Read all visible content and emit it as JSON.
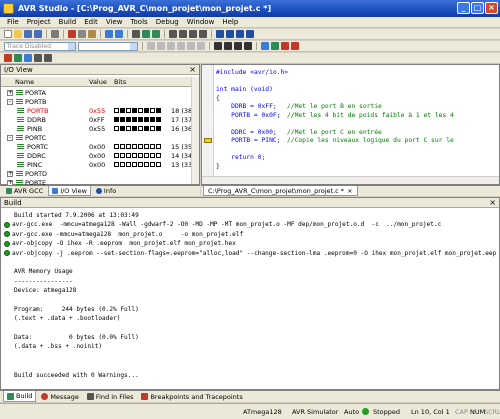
{
  "window": {
    "title": "AVR Studio - [C:\\Prog_AVR_C\\mon_projet\\mon_projet.c *]",
    "min": "_",
    "max": "□",
    "close": "×"
  },
  "menu": [
    "File",
    "Project",
    "Build",
    "Edit",
    "View",
    "Tools",
    "Debug",
    "Window",
    "Help"
  ],
  "toolbar": {
    "trace_combo": "Trace Disabled"
  },
  "io_view": {
    "title": "I/O View",
    "col_name": "Name",
    "col_value": "Value",
    "col_bits": "Bits",
    "rows": [
      {
        "expander": "+",
        "name": "PORTA",
        "value": "",
        "addr": "",
        "bits": []
      },
      {
        "expander": "-",
        "name": "PORTB",
        "value": "",
        "addr": "",
        "bits": []
      },
      {
        "expander": "",
        "name": "PORTB",
        "value": "0x55",
        "addr": "18 (38)",
        "bits": [
          0,
          1,
          0,
          1,
          0,
          1,
          0,
          1
        ],
        "red": true
      },
      {
        "expander": "",
        "name": "DDRB",
        "value": "0xFF",
        "addr": "17 (37)",
        "bits": [
          1,
          1,
          1,
          1,
          1,
          1,
          1,
          1
        ]
      },
      {
        "expander": "",
        "name": "PINB",
        "value": "0x55",
        "addr": "16 (36)",
        "bits": [
          0,
          1,
          0,
          1,
          0,
          1,
          0,
          1
        ]
      },
      {
        "expander": "-",
        "name": "PORTC",
        "value": "",
        "addr": "",
        "bits": []
      },
      {
        "expander": "",
        "name": "PORTC",
        "value": "0x00",
        "addr": "15 (35)",
        "bits": [
          0,
          0,
          0,
          0,
          0,
          0,
          0,
          0
        ]
      },
      {
        "expander": "",
        "name": "DDRC",
        "value": "0x00",
        "addr": "14 (34)",
        "bits": [
          0,
          0,
          0,
          0,
          0,
          0,
          0,
          0
        ]
      },
      {
        "expander": "",
        "name": "PINC",
        "value": "0x00",
        "addr": "13 (33)",
        "bits": [
          0,
          0,
          0,
          0,
          0,
          0,
          0,
          0
        ]
      },
      {
        "expander": "+",
        "name": "PORTD",
        "value": "",
        "addr": "",
        "bits": []
      },
      {
        "expander": "+",
        "name": "PORTE",
        "value": "",
        "addr": "",
        "bits": []
      }
    ]
  },
  "left_tabs": [
    "AVR GCC",
    "I/O View",
    "Info"
  ],
  "editor": {
    "tab": "C:\\Prog_AVR_C\\mon_projet\\mon_projet.c *",
    "lines": [
      {
        "k": "#include <avr/io.h>",
        "c": ""
      },
      {
        "k": "",
        "c": ""
      },
      {
        "k": "int main (void)",
        "c": ""
      },
      {
        "k": "{",
        "c": ""
      },
      {
        "k": "    DDRB = 0xFF;",
        "c": "//Met le port B en sortie"
      },
      {
        "k": "    PORTB = 0x0F;",
        "c": "//Met les 4 bit de poids faible à 1 et les 4"
      },
      {
        "k": "",
        "c": ""
      },
      {
        "k": "    DDRC = 0x00;",
        "c": "//Met le port C en entrée"
      },
      {
        "k": "    PORTB = PINC;",
        "c": "//Copie les niveaux logique du port C sur le"
      },
      {
        "k": "",
        "c": ""
      },
      {
        "k": "    return 0;",
        "c": ""
      },
      {
        "k": "}",
        "c": ""
      }
    ]
  },
  "build": {
    "title": "Build",
    "lines": [
      {
        "dot": false,
        "text": "Build started 7.9.2006 at 13:03:49"
      },
      {
        "dot": true,
        "text": "avr-gcc.exe  -mmcu=atmega128 -Wall -gdwarf-2 -O0 -MD -MP -MT mon_projet.o -MF dep/mon_projet.o.d  -c  ../mon_projet.c"
      },
      {
        "dot": true,
        "text": "avr-gcc.exe -mmcu=atmega128  mon_projet.o     -o mon_projet.elf"
      },
      {
        "dot": true,
        "text": "avr-objcopy -O ihex -R .eeprom  mon_projet.elf mon_projet.hex"
      },
      {
        "dot": true,
        "text": "avr-objcopy -j .eeprom --set-section-flags=.eeprom=\"alloc,load\" --change-section-lma .eeprom=0 -O ihex mon_projet.elf mon_projet.eep"
      },
      {
        "dot": false,
        "text": ""
      },
      {
        "dot": false,
        "text": "AVR Memory Usage"
      },
      {
        "dot": false,
        "text": "----------------"
      },
      {
        "dot": false,
        "text": "Device: atmega128"
      },
      {
        "dot": false,
        "text": ""
      },
      {
        "dot": false,
        "text": "Program:     244 bytes (0.2% Full)"
      },
      {
        "dot": false,
        "text": "(.text + .data + .bootloader)"
      },
      {
        "dot": false,
        "text": ""
      },
      {
        "dot": false,
        "text": "Data:          0 bytes (0.0% Full)"
      },
      {
        "dot": false,
        "text": "(.data + .bss + .noinit)"
      },
      {
        "dot": false,
        "text": ""
      },
      {
        "dot": false,
        "text": ""
      },
      {
        "dot": false,
        "text": "Build succeeded with 0 Warnings..."
      }
    ]
  },
  "build_tabs": [
    "Build",
    "Message",
    "Find in Files",
    "Breakpoints and Tracepoints"
  ],
  "status": {
    "device": "ATmega128",
    "simulator": "AVR Simulator",
    "mode": "Auto",
    "state": "Stopped",
    "position": "Ln 10, Col 1",
    "cap": "CAP",
    "num": "NUM",
    "scrl": "SCRL"
  }
}
